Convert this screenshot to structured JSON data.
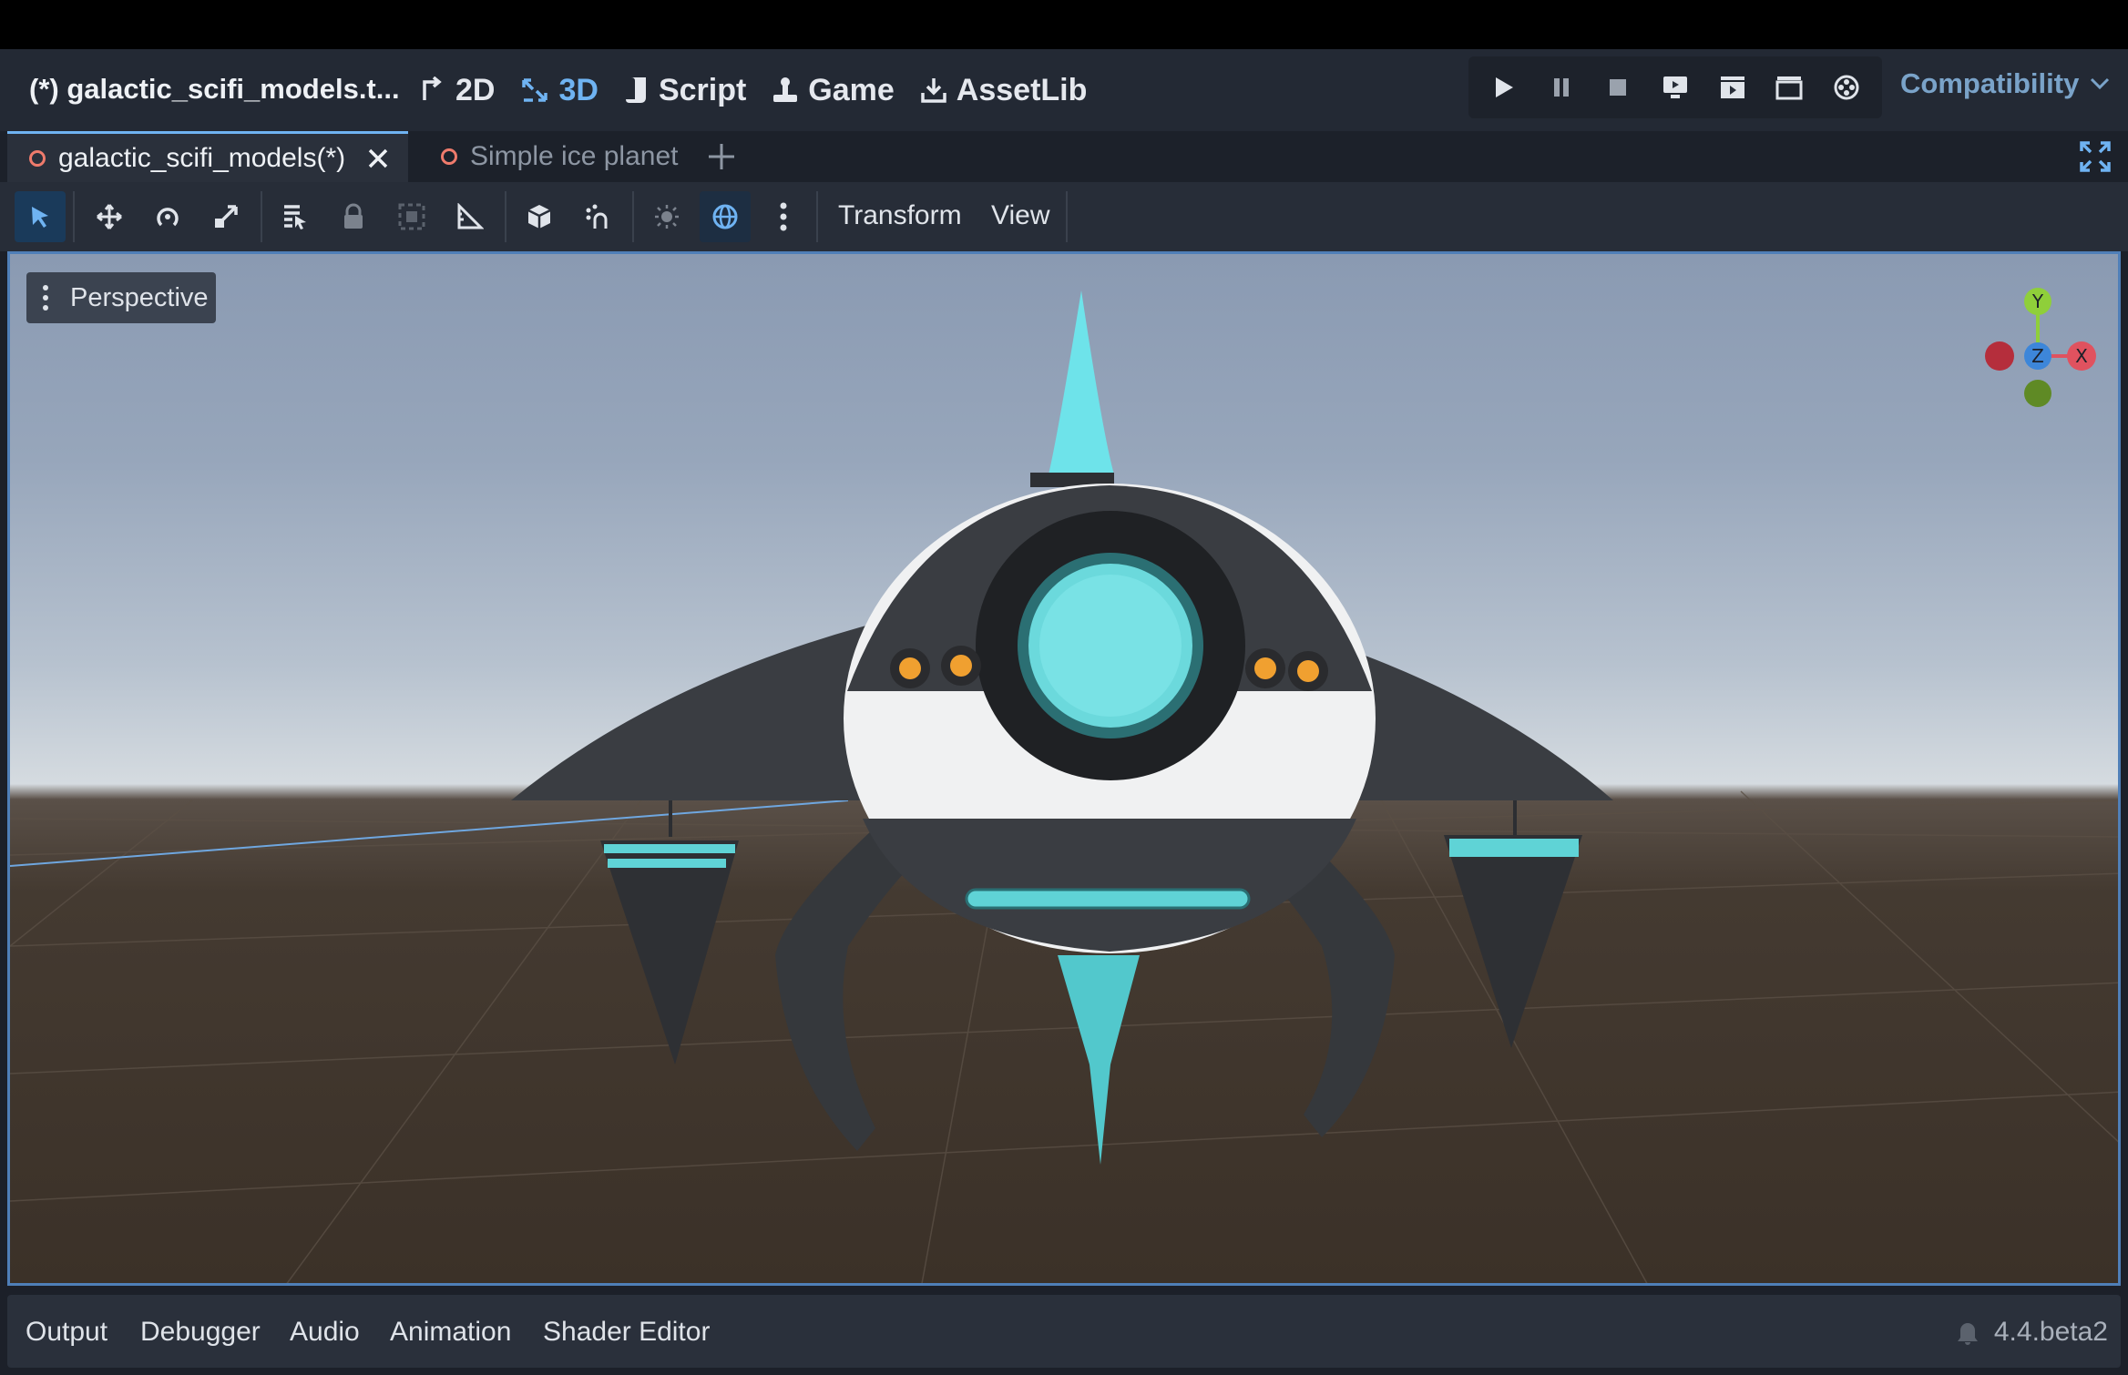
{
  "window": {
    "scene_title": "(*) galactic_scifi_models.t...",
    "renderer": "Compatibility"
  },
  "main_nav": [
    {
      "label": "2D",
      "icon": "2d-icon",
      "active": false
    },
    {
      "label": "3D",
      "icon": "3d-icon",
      "active": true
    },
    {
      "label": "Script",
      "icon": "script-icon",
      "active": false
    },
    {
      "label": "Game",
      "icon": "game-icon",
      "active": false
    },
    {
      "label": "AssetLib",
      "icon": "assetlib-icon",
      "active": false
    }
  ],
  "run_controls": [
    "play-icon",
    "pause-icon",
    "stop-icon",
    "remote-debug-icon",
    "play-scene-icon",
    "play-custom-scene-icon",
    "movie-maker-icon"
  ],
  "tabs": [
    {
      "label": "galactic_scifi_models(*)",
      "active": true
    },
    {
      "label": "Simple ice planet",
      "active": false
    }
  ],
  "toolbar": {
    "menus": [
      "Transform",
      "View"
    ]
  },
  "viewport": {
    "perspective_label": "Perspective",
    "gizmo": {
      "y": "Y",
      "z": "Z",
      "x": "X"
    }
  },
  "bottom_panel": {
    "tabs": [
      "Output",
      "Debugger",
      "Audio",
      "Animation",
      "Shader Editor"
    ],
    "version": "4.4.beta2"
  },
  "colors": {
    "accent": "#6fb3f2",
    "cyan": "#5fd3d6",
    "ship_dark": "#3a3d42",
    "ship_white": "#f2f2f2"
  }
}
